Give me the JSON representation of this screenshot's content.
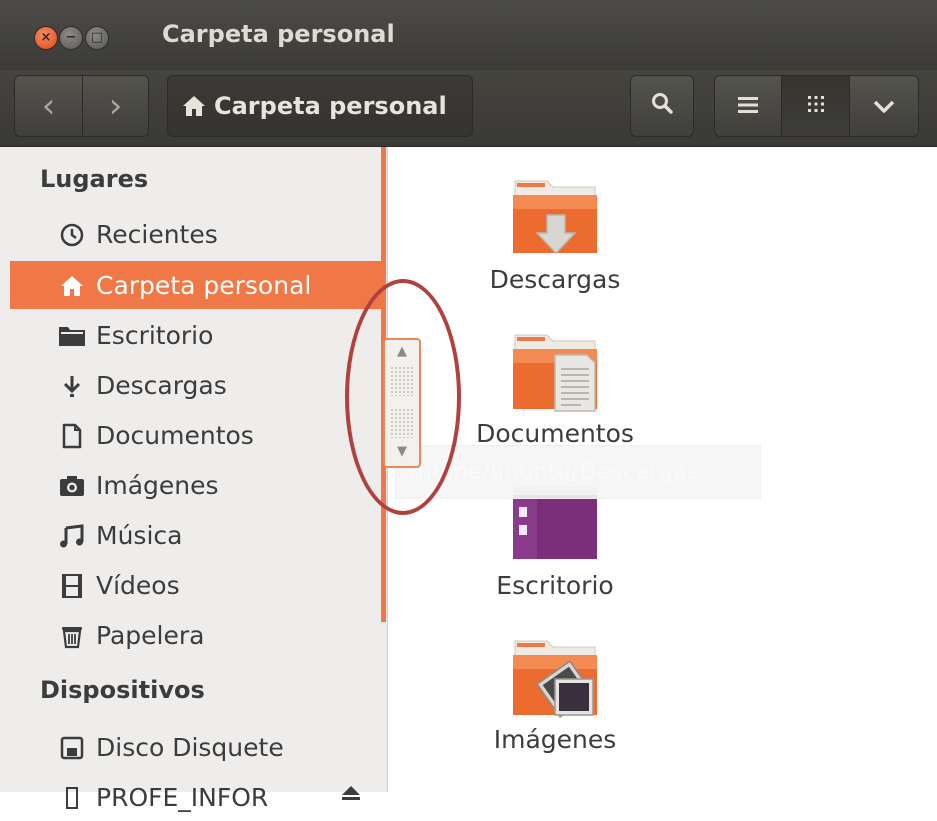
{
  "window": {
    "title": "Carpeta personal",
    "controls": {
      "close": "×",
      "minimize": "−",
      "maximize": "□"
    }
  },
  "toolbar": {
    "back_icon": "‹",
    "forward_icon": "›",
    "path_label": "Carpeta personal",
    "search_icon": "search-icon",
    "list_view_icon": "list-icon",
    "grid_view_icon": "grid-icon",
    "menu_icon": "chevron-down-icon"
  },
  "sidebar": {
    "places_heading": "Lugares",
    "places": [
      {
        "label": "Recientes",
        "icon": "clock-icon"
      },
      {
        "label": "Carpeta personal",
        "icon": "home-icon",
        "active": true
      },
      {
        "label": "Escritorio",
        "icon": "folder-icon"
      },
      {
        "label": "Descargas",
        "icon": "download-icon"
      },
      {
        "label": "Documentos",
        "icon": "document-icon"
      },
      {
        "label": "Imágenes",
        "icon": "camera-icon"
      },
      {
        "label": "Música",
        "icon": "music-icon"
      },
      {
        "label": "Vídeos",
        "icon": "film-icon"
      },
      {
        "label": "Papelera",
        "icon": "trash-icon"
      }
    ],
    "devices_heading": "Dispositivos",
    "devices": [
      {
        "label": "Disco Disquete",
        "icon": "floppy-icon"
      },
      {
        "label": "PROFE_INFOR",
        "icon": "drive-icon"
      }
    ]
  },
  "content": {
    "items": [
      {
        "name": "Descargas",
        "icon": "downloads-folder-icon"
      },
      {
        "name": "Documentos",
        "icon": "documents-folder-icon"
      },
      {
        "name": "Escritorio",
        "icon": "desktop-folder-icon"
      },
      {
        "name": "Imágenes",
        "icon": "pictures-folder-icon"
      }
    ],
    "tooltip": "/home/ubuntu/Descargas"
  },
  "colors": {
    "accent": "#f07746",
    "titlebar": "#3c3b37",
    "annotation_ring": "#b0413e"
  }
}
